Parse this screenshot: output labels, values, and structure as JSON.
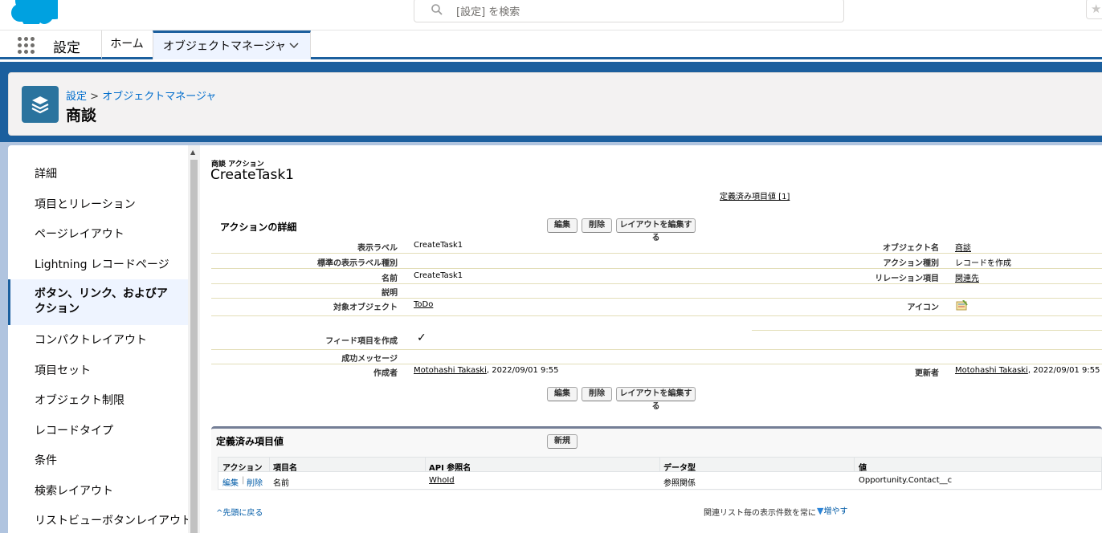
{
  "search": {
    "placeholder": "[設定] を検索"
  },
  "nav": {
    "app_name": "設定",
    "home": "ホーム",
    "object_manager": "オブジェクトマネージャ"
  },
  "header": {
    "breadcrumb_root": "設定",
    "breadcrumb_sep": ">",
    "breadcrumb_current": "オブジェクトマネージャ",
    "title": "商談"
  },
  "sidebar": {
    "items": [
      {
        "label": "詳細"
      },
      {
        "label": "項目とリレーション"
      },
      {
        "label": "ページレイアウト"
      },
      {
        "label": "Lightning レコードページ"
      },
      {
        "label": "ボタン、リンク、およびアクション",
        "active": true
      },
      {
        "label": "コンパクトレイアウト"
      },
      {
        "label": "項目セット"
      },
      {
        "label": "オブジェクト制限"
      },
      {
        "label": "レコードタイプ"
      },
      {
        "label": "条件"
      },
      {
        "label": "検索レイアウト"
      },
      {
        "label": "リストビューボタンレイアウト"
      }
    ]
  },
  "action": {
    "type_label": "商談 アクション",
    "name": "CreateTask1",
    "predefined_link": "定義済み項目値 [1]",
    "section_title": "アクションの詳細",
    "buttons": {
      "edit": "編集",
      "delete": "削除",
      "edit_layout": "レイアウトを編集する"
    },
    "fields": {
      "display_label": {
        "label": "表示ラベル",
        "value": "CreateTask1"
      },
      "standard_label_type": {
        "label": "標準の表示ラベル種別",
        "value": ""
      },
      "name": {
        "label": "名前",
        "value": "CreateTask1"
      },
      "description": {
        "label": "説明",
        "value": ""
      },
      "target_object": {
        "label": "対象オブジェクト",
        "value": "ToDo"
      },
      "create_feed": {
        "label": "フィード項目を作成",
        "value": "✓"
      },
      "success_message": {
        "label": "成功メッセージ",
        "value": ""
      },
      "created_by": {
        "label": "作成者",
        "user": "Motohashi Takaski",
        "date": ", 2022/09/01 9:55"
      },
      "object_name": {
        "label": "オブジェクト名",
        "value": "商談"
      },
      "action_type": {
        "label": "アクション種別",
        "value": "レコードを作成"
      },
      "relation_field": {
        "label": "リレーション項目",
        "value": "関連先"
      },
      "icon": {
        "label": "アイコン"
      },
      "modified_by": {
        "label": "更新者",
        "user": "Motohashi Takaski",
        "date": ", 2022/09/01 9:55"
      }
    }
  },
  "predefined": {
    "title": "定義済み項目値",
    "new_button": "新規",
    "columns": [
      "アクション",
      "項目名",
      "API 参照名",
      "データ型",
      "値"
    ],
    "rows": [
      {
        "edit": "編集",
        "sep": "|",
        "delete": "削除",
        "field": "名前",
        "api": "WhoId",
        "type": "参照関係",
        "value": "Opportunity.Contact__c"
      }
    ]
  },
  "footer": {
    "back_to_top": "先頭に戻る",
    "always_show": "関連リスト毎の表示件数を常に",
    "more": "増やす"
  },
  "colors": {
    "brand": "#1b5f9e",
    "header_icon": "#2a739e",
    "link": "#006dcc"
  }
}
